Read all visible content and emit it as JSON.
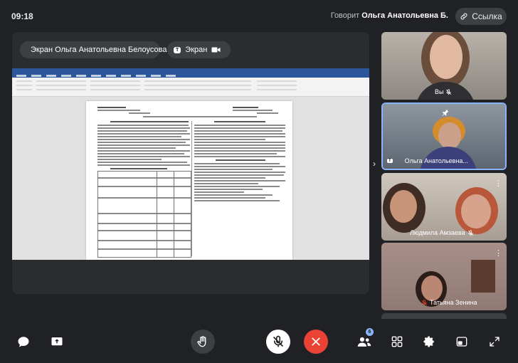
{
  "header": {
    "time": "09:18",
    "speaking_prefix": "Говорит",
    "speaking_name": "Ольга Анатольевна Б.",
    "link_label": "Ссылка"
  },
  "stage": {
    "presenter_label": "Экран Ольга Анатольевна Белоусова",
    "screen_tag": "T",
    "screen_label": "Экран"
  },
  "participants": [
    {
      "name": "Вы",
      "muted": true
    },
    {
      "name": "Ольга Анатольевна...",
      "muted": false,
      "pinned": true,
      "speaking": true
    },
    {
      "name": "Людмила Амзаева",
      "muted": true
    },
    {
      "name": "Татьяна Зенина",
      "muted": true
    }
  ],
  "toolbar": {
    "participants_count": "6",
    "chat": "chat-icon",
    "share": "share-icon",
    "raise_hand": "hand-icon",
    "mic": "mic-off-icon",
    "leave": "close-icon",
    "people": "people-icon",
    "layout": "grid-icon",
    "settings": "gear-icon",
    "pip": "pip-icon",
    "fullscreen": "fullscreen-icon"
  },
  "colors": {
    "background": "#202124",
    "tile": "#3c4043",
    "active_border": "#8ab4f8",
    "leave_red": "#ea4335"
  }
}
